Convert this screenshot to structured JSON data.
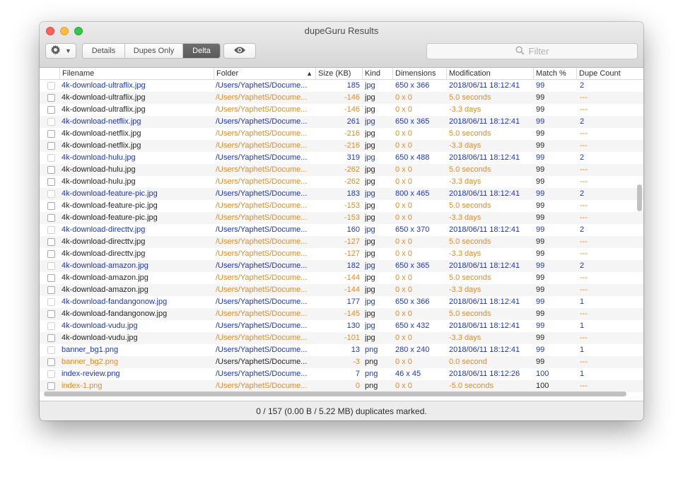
{
  "window": {
    "title": "dupeGuru Results"
  },
  "toolbar": {
    "gear_icon": "gear-icon",
    "view_modes": [
      "Details",
      "Dupes Only",
      "Delta"
    ],
    "active_mode": "Delta",
    "eye_icon": "eye-icon",
    "filter_placeholder": "Filter"
  },
  "columns": [
    "Filename",
    "Folder",
    "Size (KB)",
    "Kind",
    "Dimensions",
    "Modification",
    "Match %",
    "Dupe Count"
  ],
  "sort": {
    "column": "Folder",
    "direction": "ascending"
  },
  "colors": {
    "reference": "#1b35c8",
    "delta": "#ea8a14",
    "normal": "#262626"
  },
  "rows": [
    {
      "ref": true,
      "name": "4k-download-ultraflix.jpg",
      "folder": "/Users/YaphetS/Docume...",
      "size": "185",
      "kind": "jpg",
      "dims": "650 x 366",
      "mod": "2018/06/11 18:12:41",
      "match": "99",
      "dupe": "2"
    },
    {
      "ref": false,
      "name": "4k-download-ultraflix.jpg",
      "folder": "/Users/YaphetS/Docume...",
      "size": "-146",
      "kind": "jpg",
      "dims": "0 x 0",
      "mod": "5.0 seconds",
      "match": "99",
      "dupe": "---"
    },
    {
      "ref": false,
      "name": "4k-download-ultraflix.jpg",
      "folder": "/Users/YaphetS/Docume...",
      "size": "-146",
      "kind": "jpg",
      "dims": "0 x 0",
      "mod": "-3.3 days",
      "match": "99",
      "dupe": "---"
    },
    {
      "ref": true,
      "name": "4k-download-netflix.jpg",
      "folder": "/Users/YaphetS/Docume...",
      "size": "261",
      "kind": "jpg",
      "dims": "650 x 365",
      "mod": "2018/06/11 18:12:41",
      "match": "99",
      "dupe": "2"
    },
    {
      "ref": false,
      "name": "4k-download-netflix.jpg",
      "folder": "/Users/YaphetS/Docume...",
      "size": "-216",
      "kind": "jpg",
      "dims": "0 x 0",
      "mod": "5.0 seconds",
      "match": "99",
      "dupe": "---"
    },
    {
      "ref": false,
      "name": "4k-download-netflix.jpg",
      "folder": "/Users/YaphetS/Docume...",
      "size": "-216",
      "kind": "jpg",
      "dims": "0 x 0",
      "mod": "-3.3 days",
      "match": "99",
      "dupe": "---"
    },
    {
      "ref": true,
      "name": "4k-download-hulu.jpg",
      "folder": "/Users/YaphetS/Docume...",
      "size": "319",
      "kind": "jpg",
      "dims": "650 x 488",
      "mod": "2018/06/11 18:12:41",
      "match": "99",
      "dupe": "2"
    },
    {
      "ref": false,
      "name": "4k-download-hulu.jpg",
      "folder": "/Users/YaphetS/Docume...",
      "size": "-262",
      "kind": "jpg",
      "dims": "0 x 0",
      "mod": "5.0 seconds",
      "match": "99",
      "dupe": "---"
    },
    {
      "ref": false,
      "name": "4k-download-hulu.jpg",
      "folder": "/Users/YaphetS/Docume...",
      "size": "-262",
      "kind": "jpg",
      "dims": "0 x 0",
      "mod": "-3.3 days",
      "match": "99",
      "dupe": "---"
    },
    {
      "ref": true,
      "name": "4k-download-feature-pic.jpg",
      "folder": "/Users/YaphetS/Docume...",
      "size": "183",
      "kind": "jpg",
      "dims": "800 x 465",
      "mod": "2018/06/11 18:12:41",
      "match": "99",
      "dupe": "2"
    },
    {
      "ref": false,
      "name": "4k-download-feature-pic.jpg",
      "folder": "/Users/YaphetS/Docume...",
      "size": "-153",
      "kind": "jpg",
      "dims": "0 x 0",
      "mod": "5.0 seconds",
      "match": "99",
      "dupe": "---"
    },
    {
      "ref": false,
      "name": "4k-download-feature-pic.jpg",
      "folder": "/Users/YaphetS/Docume...",
      "size": "-153",
      "kind": "jpg",
      "dims": "0 x 0",
      "mod": "-3.3 days",
      "match": "99",
      "dupe": "---"
    },
    {
      "ref": true,
      "name": "4k-download-directtv.jpg",
      "folder": "/Users/YaphetS/Docume...",
      "size": "160",
      "kind": "jpg",
      "dims": "650 x 370",
      "mod": "2018/06/11 18:12:41",
      "match": "99",
      "dupe": "2"
    },
    {
      "ref": false,
      "name": "4k-download-directtv.jpg",
      "folder": "/Users/YaphetS/Docume...",
      "size": "-127",
      "kind": "jpg",
      "dims": "0 x 0",
      "mod": "5.0 seconds",
      "match": "99",
      "dupe": "---"
    },
    {
      "ref": false,
      "name": "4k-download-directtv.jpg",
      "folder": "/Users/YaphetS/Docume...",
      "size": "-127",
      "kind": "jpg",
      "dims": "0 x 0",
      "mod": "-3.3 days",
      "match": "99",
      "dupe": "---"
    },
    {
      "ref": true,
      "name": "4k-download-amazon.jpg",
      "folder": "/Users/YaphetS/Docume...",
      "size": "182",
      "kind": "jpg",
      "dims": "650 x 365",
      "mod": "2018/06/11 18:12:41",
      "match": "99",
      "dupe": "2"
    },
    {
      "ref": false,
      "name": "4k-download-amazon.jpg",
      "folder": "/Users/YaphetS/Docume...",
      "size": "-144",
      "kind": "jpg",
      "dims": "0 x 0",
      "mod": "5.0 seconds",
      "match": "99",
      "dupe": "---"
    },
    {
      "ref": false,
      "name": "4k-download-amazon.jpg",
      "folder": "/Users/YaphetS/Docume...",
      "size": "-144",
      "kind": "jpg",
      "dims": "0 x 0",
      "mod": "-3.3 days",
      "match": "99",
      "dupe": "---"
    },
    {
      "ref": true,
      "name": "4k-download-fandangonow.jpg",
      "folder": "/Users/YaphetS/Docume...",
      "size": "177",
      "kind": "jpg",
      "dims": "650 x 366",
      "mod": "2018/06/11 18:12:41",
      "match": "99",
      "dupe": "1"
    },
    {
      "ref": false,
      "name": "4k-download-fandangonow.jpg",
      "folder": "/Users/YaphetS/Docume...",
      "size": "-145",
      "kind": "jpg",
      "dims": "0 x 0",
      "mod": "5.0 seconds",
      "match": "99",
      "dupe": "---"
    },
    {
      "ref": true,
      "name": "4k-download-vudu.jpg",
      "folder": "/Users/YaphetS/Docume...",
      "size": "130",
      "kind": "jpg",
      "dims": "650 x 432",
      "mod": "2018/06/11 18:12:41",
      "match": "99",
      "dupe": "1"
    },
    {
      "ref": false,
      "name": "4k-download-vudu.jpg",
      "folder": "/Users/YaphetS/Docume...",
      "size": "-101",
      "kind": "jpg",
      "dims": "0 x 0",
      "mod": "-3.3 days",
      "match": "99",
      "dupe": "---"
    },
    {
      "ref": true,
      "name": "banner_bg1.png",
      "folder": "/Users/YaphetS/Docume...",
      "size": "13",
      "kind": "png",
      "dims": "280 x 240",
      "mod": "2018/06/11 18:12:41",
      "match": "99",
      "dupe": "1"
    },
    {
      "ref": false,
      "name": "banner_bg2.png",
      "folder": "/Users/YaphetS/Docume...",
      "size": "-3",
      "kind": "png",
      "dims": "0 x 0",
      "mod": "0.0 second",
      "match": "99",
      "dupe": "---",
      "name_delta": true
    },
    {
      "ref": true,
      "name": "index-review.png",
      "folder": "/Users/YaphetS/Docume...",
      "size": "7",
      "kind": "png",
      "dims": "46 x 45",
      "mod": "2018/06/11 18:12:26",
      "match": "100",
      "dupe": "1"
    },
    {
      "ref": false,
      "name": "index-1.png",
      "folder": "/Users/YaphetS/Docume...",
      "size": "0",
      "kind": "png",
      "dims": "0 x 0",
      "mod": "-5.0 seconds",
      "match": "100",
      "dupe": "---",
      "name_delta": true,
      "folder_delta": true
    }
  ],
  "status": {
    "text": "0 / 157 (0.00 B / 5.22 MB) duplicates marked."
  }
}
